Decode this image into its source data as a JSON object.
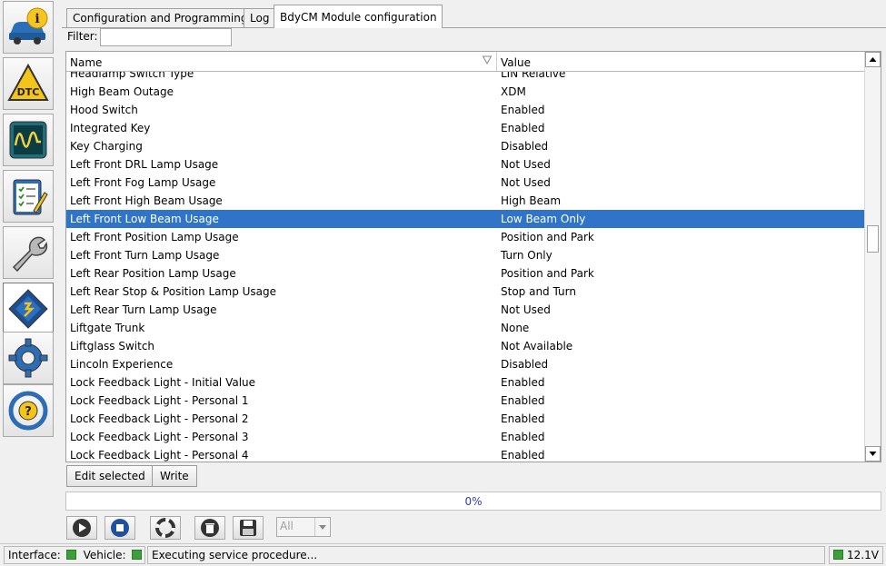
{
  "tabs": [
    {
      "label": "Configuration and Programming"
    },
    {
      "label": "Log"
    },
    {
      "label": "BdyCM Module configuration"
    }
  ],
  "filter": {
    "label": "Filter:",
    "value": ""
  },
  "grid": {
    "columns": [
      "Name",
      "Value"
    ],
    "rows": [
      {
        "name": "Headlamp Switch Type",
        "value": "LIN Relative"
      },
      {
        "name": "High Beam Outage",
        "value": "XDM"
      },
      {
        "name": "Hood Switch",
        "value": "Enabled"
      },
      {
        "name": "Integrated Key",
        "value": "Enabled"
      },
      {
        "name": "Key Charging",
        "value": "Disabled"
      },
      {
        "name": "Left Front DRL Lamp Usage",
        "value": "Not Used"
      },
      {
        "name": "Left Front Fog Lamp Usage",
        "value": "Not Used"
      },
      {
        "name": "Left Front High Beam Usage",
        "value": "High Beam"
      },
      {
        "name": "Left Front Low Beam Usage",
        "value": "Low Beam Only"
      },
      {
        "name": "Left Front Position Lamp Usage",
        "value": "Position and Park"
      },
      {
        "name": "Left Front Turn Lamp Usage",
        "value": "Turn Only"
      },
      {
        "name": "Left Rear Position Lamp Usage",
        "value": "Position and Park"
      },
      {
        "name": "Left Rear Stop & Position Lamp Usage",
        "value": "Stop and Turn"
      },
      {
        "name": "Left Rear Turn Lamp Usage",
        "value": "Not Used"
      },
      {
        "name": "Liftgate Trunk",
        "value": "None"
      },
      {
        "name": "Liftglass Switch",
        "value": "Not Available"
      },
      {
        "name": "Lincoln Experience",
        "value": "Disabled"
      },
      {
        "name": "Lock Feedback Light - Initial Value",
        "value": "Enabled"
      },
      {
        "name": "Lock Feedback Light - Personal 1",
        "value": "Enabled"
      },
      {
        "name": "Lock Feedback Light - Personal 2",
        "value": "Enabled"
      },
      {
        "name": "Lock Feedback Light - Personal 3",
        "value": "Enabled"
      },
      {
        "name": "Lock Feedback Light - Personal 4",
        "value": "Enabled"
      }
    ],
    "selected_row": "Left Front Low Beam Usage",
    "scroll_position": 0.45
  },
  "actions": {
    "edit_selected": "Edit selected",
    "write": "Write"
  },
  "progress": {
    "text": "0%",
    "value": 0
  },
  "toolbar": {
    "icons": [
      "play-icon",
      "stop-icon",
      "lifebuoy-icon",
      "trash-icon",
      "save-icon"
    ],
    "select_value": "All"
  },
  "sidebar": {
    "icons": [
      "car-info-icon",
      "dtc-icon",
      "oscilloscope-icon",
      "checklist-icon",
      "wrench-icon",
      "chip-icon",
      "gear-icon",
      "steering-wheel-help-icon"
    ],
    "active": "chip-icon"
  },
  "status": {
    "interface_label": "Interface:",
    "vehicle_label": "Vehicle:",
    "message": "Executing service procedure...",
    "voltage": "12.1V",
    "led_color": "#3ba03b"
  },
  "colors": {
    "selection": "#3074c9",
    "progress_text": "#2c3fb4"
  }
}
